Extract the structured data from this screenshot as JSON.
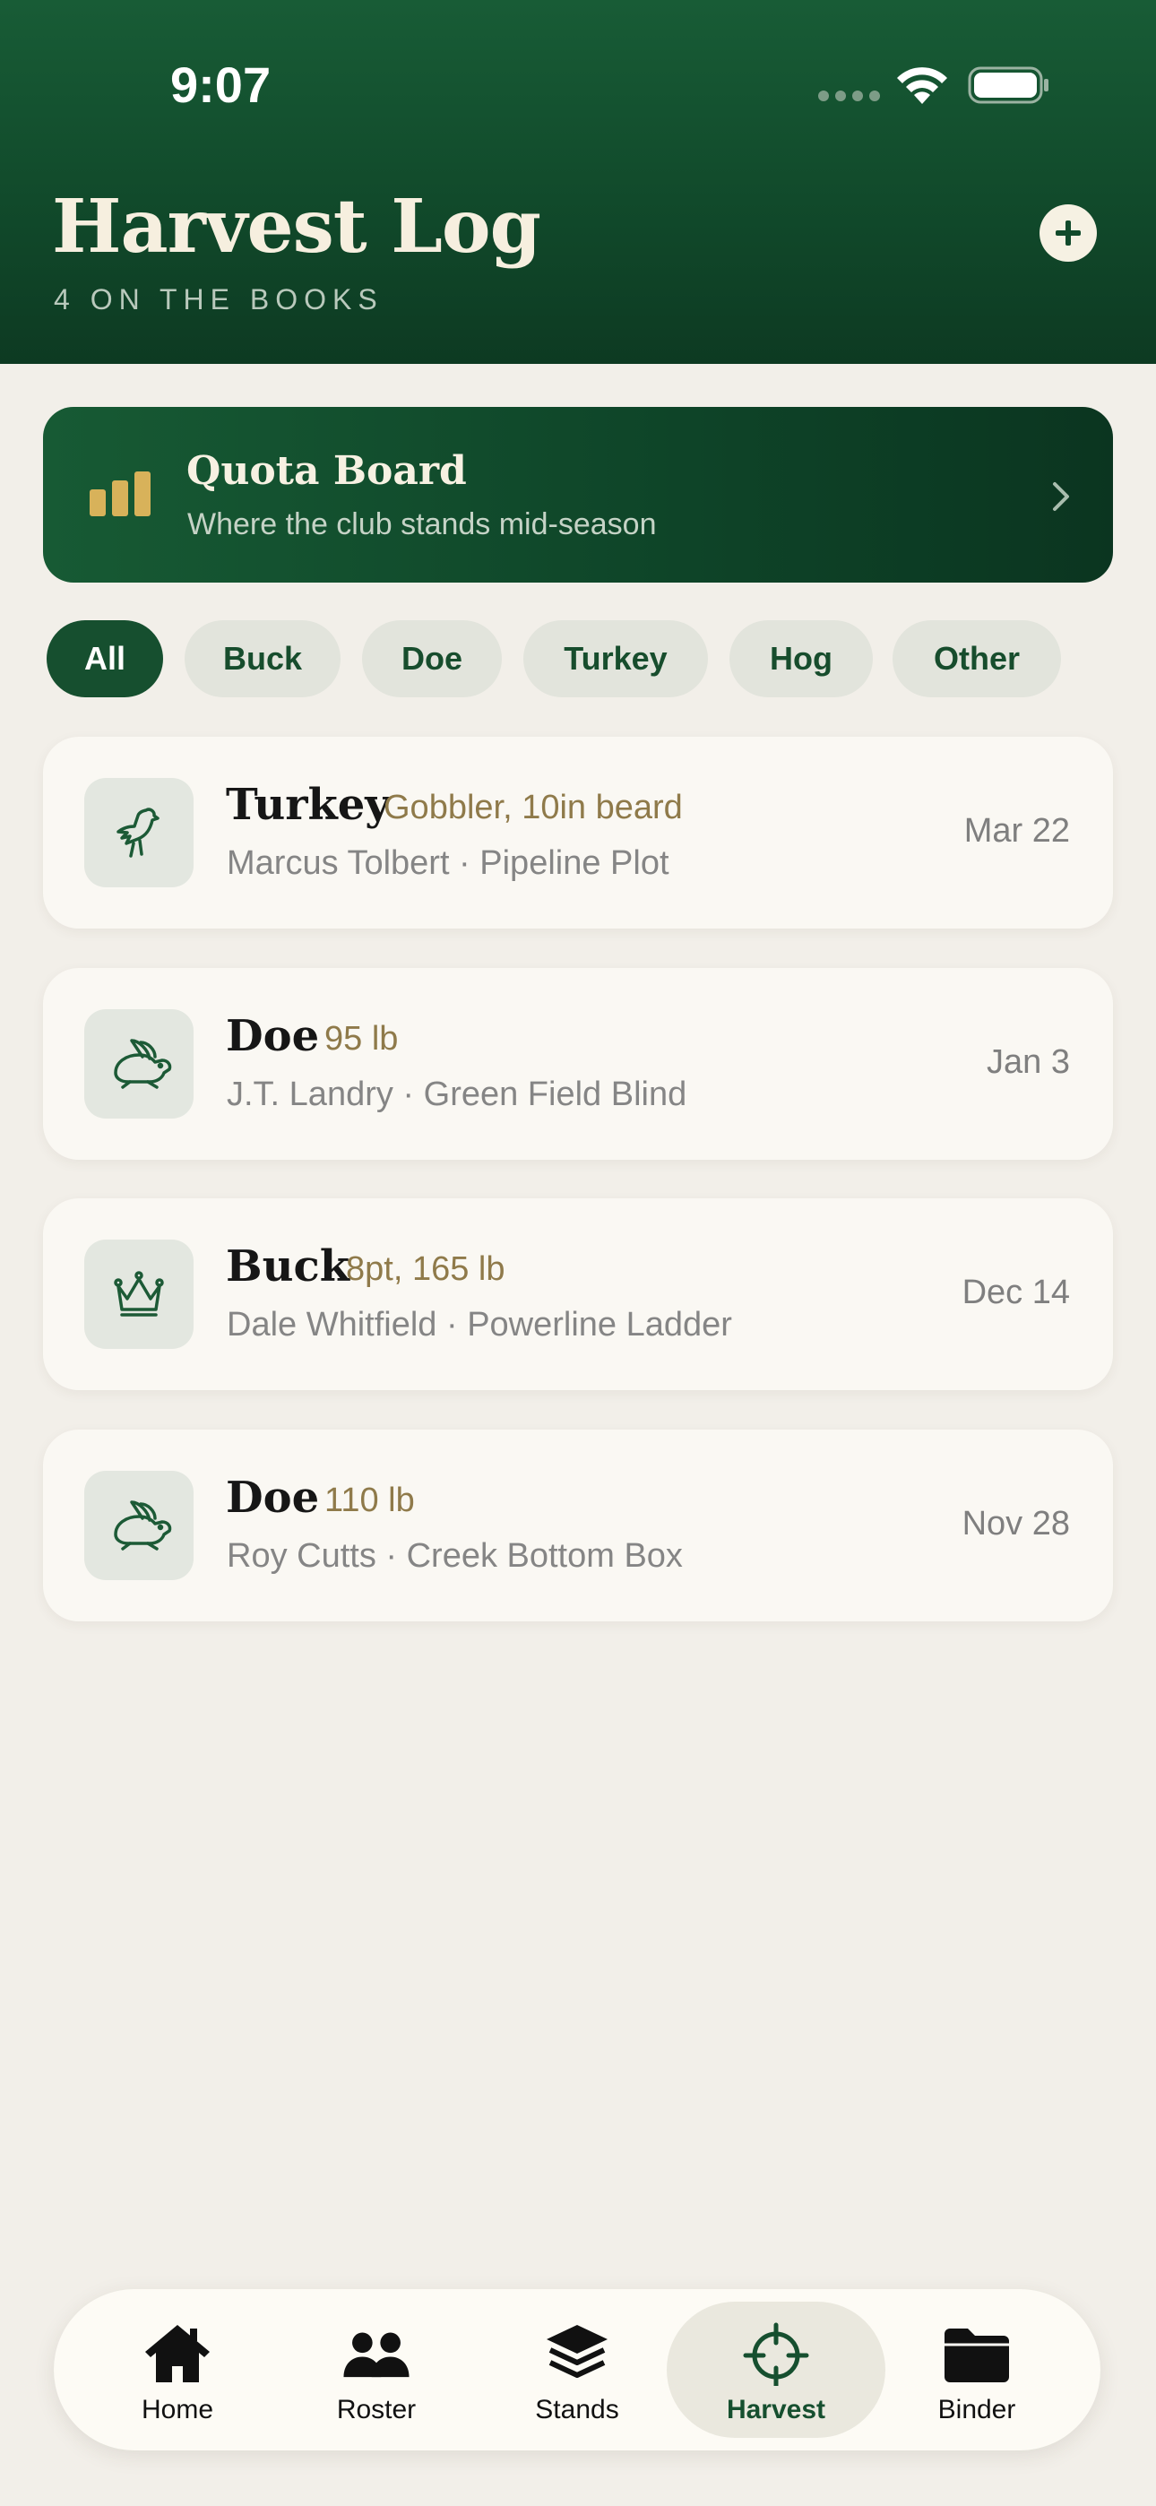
{
  "status_bar": {
    "time": "9:07"
  },
  "header": {
    "title": "Harvest Log",
    "subtitle": "4 ON THE BOOKS",
    "add_icon": "plus-circle-icon"
  },
  "quota_board": {
    "title": "Quota Board",
    "subtitle": "Where the club stands mid-season",
    "icon": "bar-chart-icon",
    "accent": "#d8b25a"
  },
  "filters": {
    "active": "All",
    "chips": [
      "All",
      "Buck",
      "Doe",
      "Turkey",
      "Hog",
      "Other"
    ]
  },
  "harvests": [
    {
      "species": "Turkey",
      "detail": "Gobbler, 10in beard",
      "hunter": "Marcus Tolbert",
      "stand": "Pipeline Plot",
      "meta": "Marcus Tolbert · Pipeline Plot",
      "date": "Mar 22",
      "icon": "bird-icon"
    },
    {
      "species": "Doe",
      "detail": "95 lb",
      "hunter": "J.T. Landry",
      "stand": "Green Field Blind",
      "meta": "J.T. Landry · Green Field Blind",
      "date": "Jan 3",
      "icon": "rabbit-icon"
    },
    {
      "species": "Buck",
      "detail": "8pt, 165 lb",
      "hunter": "Dale Whitfield",
      "stand": "Powerline Ladder",
      "meta": "Dale Whitfield · Powerline Ladder",
      "date": "Dec 14",
      "icon": "crown-icon"
    },
    {
      "species": "Doe",
      "detail": "110 lb",
      "hunter": "Roy Cutts",
      "stand": "Creek Bottom Box",
      "meta": "Roy Cutts · Creek Bottom Box",
      "date": "Nov 28",
      "icon": "rabbit-icon"
    }
  ],
  "tabbar": {
    "active": "Harvest",
    "tabs": [
      {
        "label": "Home",
        "icon": "home-icon"
      },
      {
        "label": "Roster",
        "icon": "people-icon"
      },
      {
        "label": "Stands",
        "icon": "layers-icon"
      },
      {
        "label": "Harvest",
        "icon": "crosshair-icon"
      },
      {
        "label": "Binder",
        "icon": "folder-icon"
      }
    ]
  },
  "colors": {
    "header_green": "#185c36",
    "brand_green": "#164f2f",
    "background": "#f2efe9",
    "detail_tan": "#8f7a4a"
  }
}
